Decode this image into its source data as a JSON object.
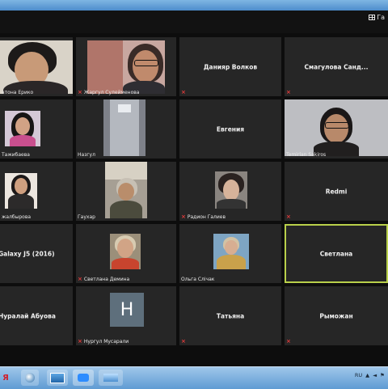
{
  "view_switch": "Га",
  "participants": [
    {
      "label": "атона Ерико",
      "mic_off": true,
      "video": true
    },
    {
      "label": "Жаргул Сулейменова",
      "mic_off": true,
      "video": true
    },
    {
      "label": "Данияр Волков",
      "mic_off": true,
      "video": false,
      "center": "Данияр Волков"
    },
    {
      "label": "Смагулова Санд...",
      "mic_off": true,
      "video": false,
      "center": "Смагулова  Санд..."
    },
    {
      "label": "Тажибаева",
      "mic_off": false,
      "video": true
    },
    {
      "label": "Назгул",
      "mic_off": false,
      "video": true
    },
    {
      "label": "Евгения",
      "mic_off": false,
      "video": false,
      "center": "Евгения"
    },
    {
      "label": "Temirlan Sakiros",
      "mic_off": false,
      "video": true
    },
    {
      "label": "жалбырова",
      "mic_off": false,
      "video": true
    },
    {
      "label": "Гаухар",
      "mic_off": false,
      "video": true
    },
    {
      "label": "Радион Галиев",
      "mic_off": true,
      "video": true
    },
    {
      "label": "Redmi",
      "mic_off": true,
      "video": false,
      "center": "Redmi"
    },
    {
      "label": "Galaxy J5 (2016)",
      "mic_off": false,
      "video": false,
      "center": "Galaxy J5 (2016)"
    },
    {
      "label": "Светлана Демина",
      "mic_off": true,
      "video": true
    },
    {
      "label": "Ольга Слічак",
      "mic_off": false,
      "video": true
    },
    {
      "label": "Светлана",
      "mic_off": false,
      "video": false,
      "center": "Светлана",
      "active": true
    },
    {
      "label": "Нуралай Абуова",
      "mic_off": false,
      "video": false,
      "center": "Нуралай Абуова"
    },
    {
      "label": "Нургул Мусарали",
      "mic_off": true,
      "video": false,
      "avatar": "H"
    },
    {
      "label": "Татьяна",
      "mic_off": true,
      "video": false,
      "center": "Татьяна"
    },
    {
      "label": "Рыможан",
      "mic_off": true,
      "video": false,
      "center": "Рыможан"
    }
  ],
  "tray": {
    "lang": "RU"
  },
  "colors": {
    "active_border": "#b9d04a",
    "mic_off": "#e23b3b",
    "tile_bg": "#262626"
  }
}
